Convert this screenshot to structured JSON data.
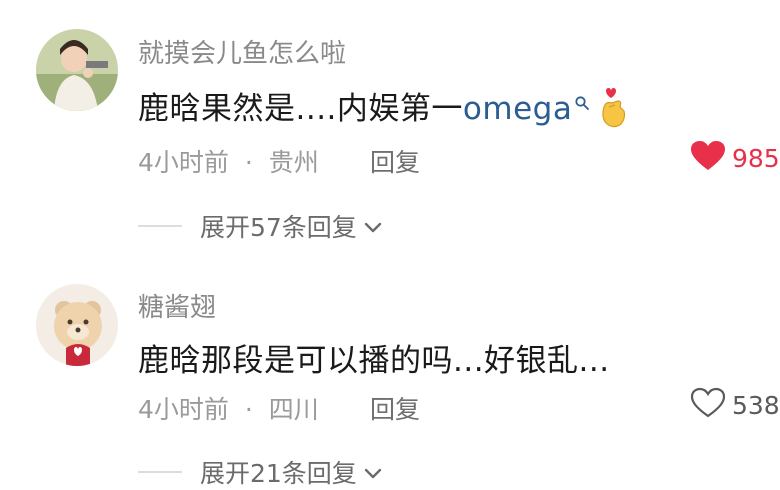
{
  "comments": [
    {
      "username": "就摸会儿鱼怎么啦",
      "text_prefix": "鹿晗果然是....内娱第一",
      "link_text": "omega",
      "time": "4小时前",
      "separator": "·",
      "location": "贵州",
      "reply_label": "回复",
      "like_count": "985",
      "liked": true,
      "expand_label": "展开57条回复"
    },
    {
      "username": "糖酱翅",
      "text": "鹿晗那段是可以播的吗...好银乱...",
      "time": "4小时前",
      "separator": "·",
      "location": "四川",
      "reply_label": "回复",
      "like_count": "538",
      "liked": false,
      "expand_label": "展开21条回复"
    }
  ],
  "colors": {
    "like_active": "#e8304a",
    "link": "#2b5d93",
    "muted": "#9a9a9a"
  },
  "icons": [
    "avatar",
    "search-icon",
    "heart-hand-emoji",
    "heart-filled-icon",
    "heart-outline-icon",
    "chevron-down-icon"
  ]
}
